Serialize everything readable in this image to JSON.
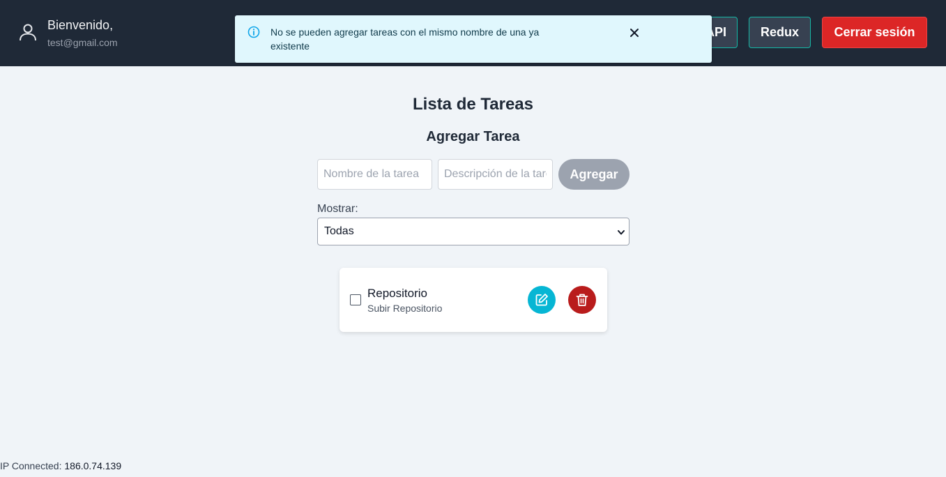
{
  "header": {
    "greeting": "Bienvenido,",
    "email": "test@gmail.com",
    "nav_buttons": {
      "api": "API",
      "redux": "Redux",
      "logout": "Cerrar sesión"
    }
  },
  "toast": {
    "message": "No se pueden agregar tareas con el mismo nombre de una ya existente"
  },
  "main": {
    "title": "Lista de Tareas",
    "add_section_title": "Agregar Tarea",
    "name_placeholder": "Nombre de la tarea",
    "description_placeholder": "Descripción de la tarea",
    "add_button": "Agregar",
    "filter_label": "Mostrar:",
    "filter_selected": "Todas"
  },
  "tasks": [
    {
      "title": "Repositorio",
      "description": "Subir Repositorio",
      "completed": false
    }
  ],
  "footer": {
    "ip_label": "IP Connected:",
    "ip_value": "186.0.74.139"
  },
  "colors": {
    "navbar": "#1f2937",
    "logout": "#dc2626",
    "edit": "#06b6d4",
    "delete": "#b91c1c",
    "toast_bg": "#e0f7fd"
  },
  "icons": [
    "user-icon",
    "info-icon",
    "close-icon",
    "chevron-down-icon",
    "edit-icon",
    "trash-icon"
  ]
}
